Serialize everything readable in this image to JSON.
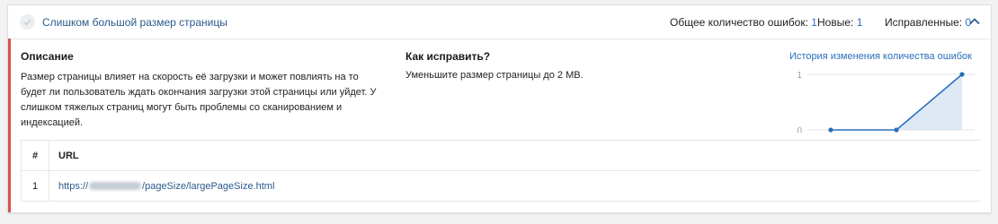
{
  "issue": {
    "title": "Слишком большой размер страницы",
    "stats": {
      "total_label": "Общее количество ошибок:",
      "total_value": "1",
      "new_label": "Новые:",
      "new_value": "1",
      "fixed_label": "Исправленные:",
      "fixed_value": "0"
    },
    "accent_color": "#d9534f"
  },
  "description": {
    "heading": "Описание",
    "text": "Размер страницы влияет на скорость её загрузки и может повлиять на то будет ли пользователь ждать окончания загрузки этой страницы или уйдет. У слишком тяжелых страниц могут быть проблемы со сканированием и индексацией."
  },
  "fix": {
    "heading": "Как исправить?",
    "text": "Уменьшите размер страницы до 2 MB."
  },
  "history": {
    "title": "История изменения количества ошибок"
  },
  "chart_data": {
    "type": "area",
    "title": "История изменения количества ошибок",
    "x": [
      1,
      2,
      3
    ],
    "values": [
      0,
      0,
      1
    ],
    "ylim": [
      0,
      1
    ],
    "y_ticks": [
      "0",
      "1"
    ],
    "color": "#2a6ebb"
  },
  "table": {
    "headers": [
      "#",
      "URL"
    ],
    "rows": [
      {
        "num": "1",
        "url_prefix": "https://",
        "url_suffix": "/pageSize/largePageSize.html"
      }
    ]
  }
}
